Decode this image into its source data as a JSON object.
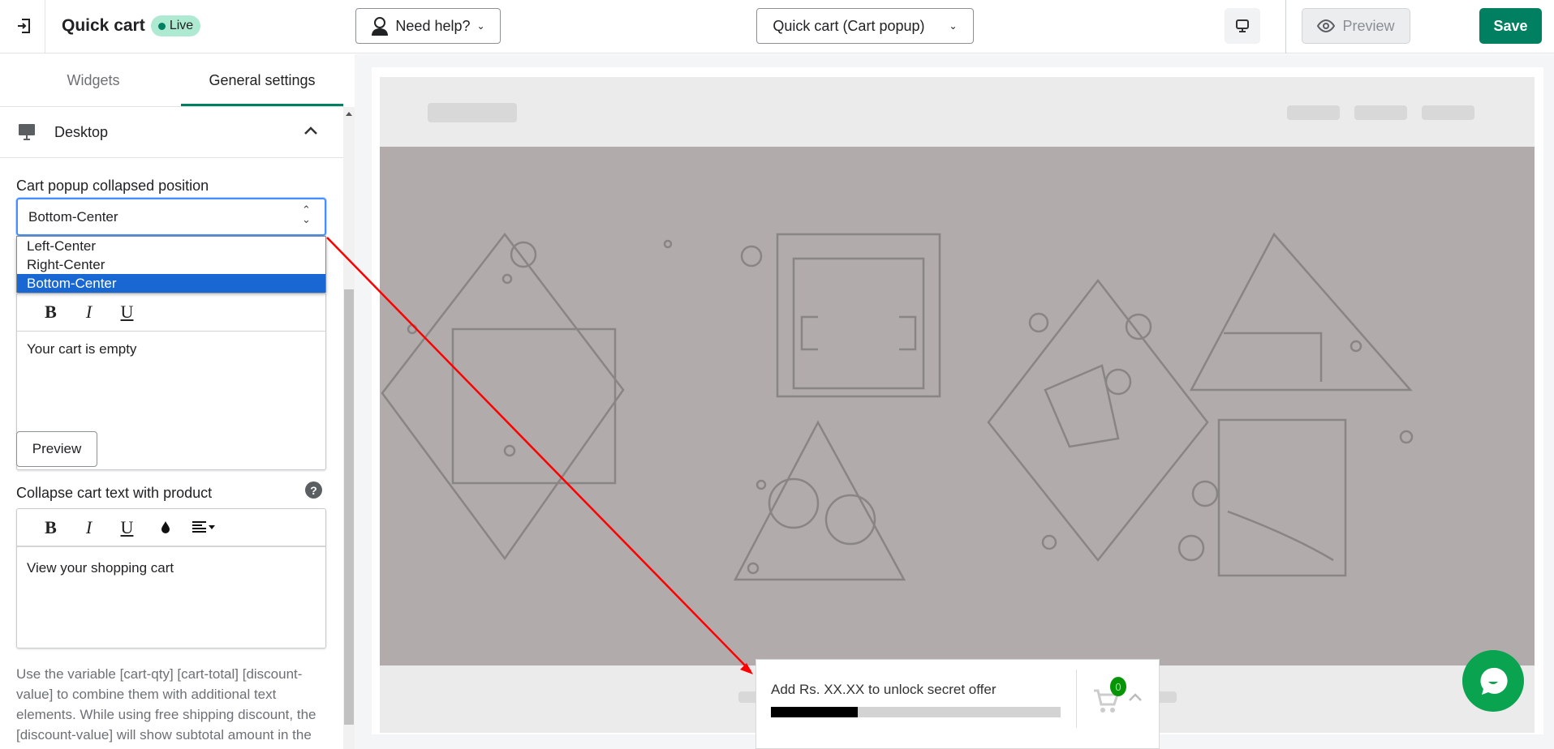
{
  "header": {
    "title": "Quick cart",
    "status_badge": "Live",
    "help_button": "Need help?",
    "view_select": "Quick cart (Cart popup)",
    "preview_button": "Preview",
    "save_button": "Save"
  },
  "tabs": [
    {
      "label": "Widgets",
      "active": false
    },
    {
      "label": "General settings",
      "active": true
    }
  ],
  "section": {
    "title": "Desktop",
    "expanded": true
  },
  "position_field": {
    "label": "Cart popup collapsed position",
    "value": "Bottom-Center",
    "options": [
      "Left-Center",
      "Right-Center",
      "Bottom-Center"
    ]
  },
  "empty_cart_editor": {
    "content": "Your cart is empty"
  },
  "preview_small_button": "Preview",
  "collapse_field": {
    "label": "Collapse cart text with product",
    "content": "View your shopping cart"
  },
  "toolbar_buttons": {
    "bold": "B",
    "italic": "I",
    "underline": "U"
  },
  "help_text": "Use the variable [cart-qty] [cart-total] [discount-value] to combine them with additional text elements. While using free shipping discount, the [discount-value] will show subtotal amount in the",
  "cart_popup": {
    "message": "Add Rs. XX.XX to unlock secret offer",
    "progress_percent": 30,
    "cart_count": "0"
  },
  "colors": {
    "accent": "#008060",
    "live_badge": "#aee9d1",
    "chat": "#0aa350",
    "highlight": "#1967d2",
    "annotation_arrow": "#ff0000"
  }
}
